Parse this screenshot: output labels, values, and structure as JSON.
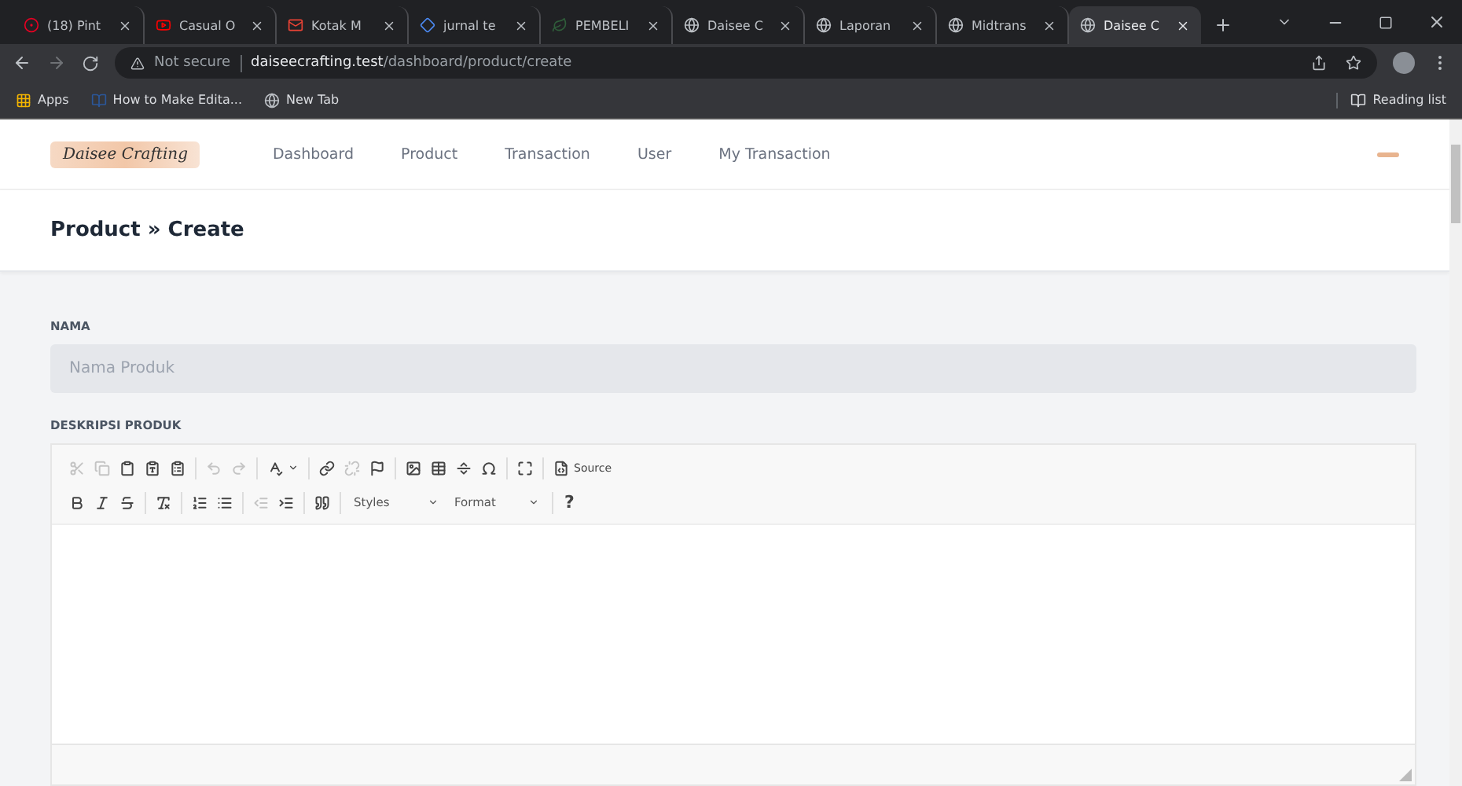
{
  "browser": {
    "tabs": [
      {
        "title": "(18) Pint",
        "kind": "pin",
        "selected": false
      },
      {
        "title": "Casual O",
        "kind": "video",
        "selected": false
      },
      {
        "title": "Kotak M",
        "kind": "mail",
        "selected": false
      },
      {
        "title": "jurnal te",
        "kind": "diamond",
        "selected": false
      },
      {
        "title": "PEMBELI",
        "kind": "leaf",
        "selected": false
      },
      {
        "title": "Daisee C",
        "kind": "globe",
        "selected": false
      },
      {
        "title": "Laporan",
        "kind": "globe",
        "selected": false
      },
      {
        "title": "Midtrans",
        "kind": "globe",
        "selected": false
      },
      {
        "title": "Daisee C",
        "kind": "globe",
        "selected": true
      }
    ],
    "security": "Not secure",
    "url_host": "daiseecrafting.test",
    "url_path": "/dashboard/product/create",
    "bookmarks": [
      {
        "label": "Apps",
        "kind": "apps"
      },
      {
        "label": "How to Make Edita...",
        "kind": "word"
      },
      {
        "label": "New Tab",
        "kind": "globe"
      }
    ],
    "reading_list": "Reading list"
  },
  "navbar": {
    "logo": "Daisee Crafting",
    "links": [
      "Dashboard",
      "Product",
      "Transaction",
      "User",
      "My Transaction"
    ]
  },
  "page_title": "Product » Create",
  "form": {
    "name_label": "NAMA",
    "name_placeholder": "Nama Produk",
    "description_label": "DESKRIPSI PRODUK",
    "toolbar_rows": [
      [
        {
          "kind": "cut",
          "disabled": true
        },
        {
          "kind": "copy",
          "disabled": true
        },
        {
          "kind": "paste",
          "disabled": false
        },
        {
          "kind": "paste-text",
          "disabled": false
        },
        {
          "kind": "paste-word",
          "disabled": false
        },
        {
          "kind": "separator"
        },
        {
          "kind": "undo",
          "disabled": true
        },
        {
          "kind": "redo",
          "disabled": true
        },
        {
          "kind": "separator"
        },
        {
          "kind": "spellcheck",
          "disabled": false
        },
        {
          "kind": "separator"
        },
        {
          "kind": "link",
          "disabled": false
        },
        {
          "kind": "unlink",
          "disabled": true
        },
        {
          "kind": "anchor",
          "disabled": false
        },
        {
          "kind": "separator"
        },
        {
          "kind": "image",
          "disabled": false
        },
        {
          "kind": "table",
          "disabled": false
        },
        {
          "kind": "rule",
          "disabled": false
        },
        {
          "kind": "omega",
          "disabled": false
        },
        {
          "kind": "separator"
        },
        {
          "kind": "maximize",
          "disabled": false
        },
        {
          "kind": "separator"
        },
        {
          "kind": "source",
          "label": "Source",
          "disabled": false
        }
      ],
      [
        {
          "kind": "bold",
          "disabled": false
        },
        {
          "kind": "italic",
          "disabled": false
        },
        {
          "kind": "strike",
          "disabled": false
        },
        {
          "kind": "separator"
        },
        {
          "kind": "clear-format",
          "disabled": false
        },
        {
          "kind": "separator"
        },
        {
          "kind": "ordered-list",
          "disabled": false
        },
        {
          "kind": "bullet-list",
          "disabled": false
        },
        {
          "kind": "separator"
        },
        {
          "kind": "outdent",
          "disabled": true
        },
        {
          "kind": "indent",
          "disabled": false
        },
        {
          "kind": "separator"
        },
        {
          "kind": "quote",
          "disabled": false
        },
        {
          "kind": "separator"
        },
        {
          "kind": "combo",
          "label": "Styles"
        },
        {
          "kind": "combo",
          "label": "Format"
        },
        {
          "kind": "separator"
        },
        {
          "kind": "help",
          "label": "?"
        }
      ]
    ]
  }
}
